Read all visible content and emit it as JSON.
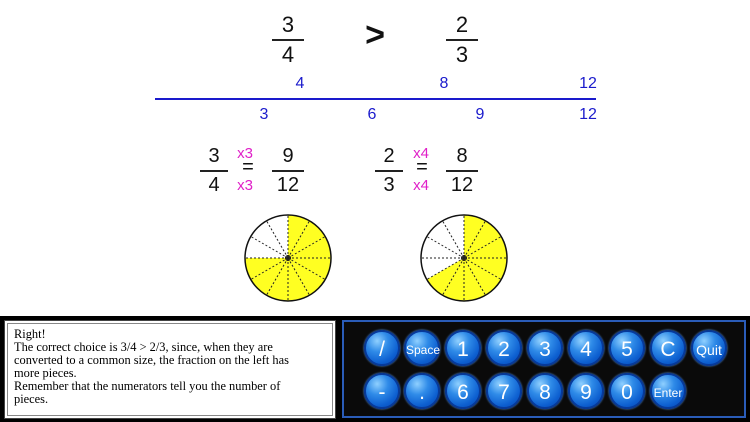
{
  "comparison": {
    "left": {
      "numerator": "3",
      "denominator": "4"
    },
    "symbol": ">",
    "right": {
      "numerator": "2",
      "denominator": "3"
    }
  },
  "number_line": {
    "top_labels": [
      "4",
      "8",
      "12"
    ],
    "bottom_labels": [
      "3",
      "6",
      "9",
      "12"
    ]
  },
  "conversions": {
    "left": {
      "numerator": "3",
      "denominator": "4",
      "mult_top": "x3",
      "mult_bottom": "x3",
      "equals": "=",
      "result_numerator": "9",
      "result_denominator": "12"
    },
    "right": {
      "numerator": "2",
      "denominator": "3",
      "mult_top": "x4",
      "mult_bottom": "x4",
      "equals": "=",
      "result_numerator": "8",
      "result_denominator": "12"
    }
  },
  "pies": {
    "left": {
      "pieces": 12,
      "filled": 9
    },
    "right": {
      "pieces": 12,
      "filled": 8
    },
    "fill_color": "#ffff22"
  },
  "message": {
    "lines": [
      "Right!",
      "The correct choice is  3/4  >  2/3,  since,  when they are",
      "converted to a common size,  the fraction on the left has",
      "more pieces.",
      "Remember that the numerators tell you the number of",
      "pieces."
    ]
  },
  "keypad": {
    "row1": [
      "/",
      "Space",
      "1",
      "2",
      "3",
      "4",
      "5",
      "C",
      "Quit"
    ],
    "row2": [
      "-",
      ".",
      "6",
      "7",
      "8",
      "9",
      "0",
      "Enter"
    ]
  },
  "colors": {
    "blue": "#1a1acc",
    "magenta": "#e020c8",
    "key_blue": "#1565d8"
  }
}
